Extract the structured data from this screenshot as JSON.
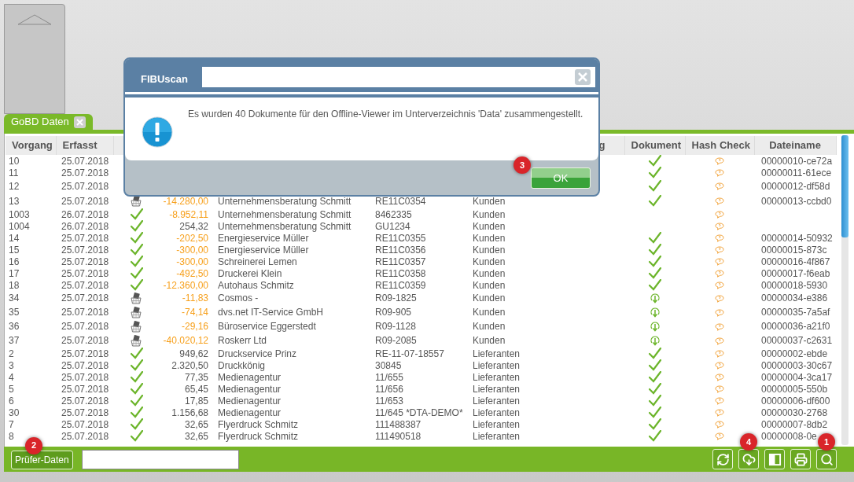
{
  "tab": {
    "label": "GoBD Daten"
  },
  "table": {
    "columns": [
      {
        "label": "Vorgang"
      },
      {
        "label": "Erfasst"
      },
      {
        "label": "g"
      },
      {
        "label": "Dokument"
      },
      {
        "label": "Hash Check"
      },
      {
        "label": "Dateiname"
      }
    ],
    "rows": [
      {
        "vorgang": "10",
        "erfasst": "25.07.2018",
        "dokument": {
          "kind": "check"
        },
        "dateiname": "00000010-ce72a"
      },
      {
        "vorgang": "11",
        "erfasst": "25.07.2018",
        "dokument": {
          "kind": "check"
        },
        "dateiname": "00000011-61ece"
      },
      {
        "vorgang": "12",
        "erfasst": "25.07.2018",
        "dokument": {
          "kind": "check"
        },
        "dateiname": "00000012-df58d"
      },
      {
        "vorgang": "13",
        "erfasst": "25.07.2018",
        "status": {
          "kind": "basket"
        },
        "amount": "-14.280,00",
        "negative": true,
        "name": "Unternehmensberatung Schmitt",
        "beleg": "RE11C0354",
        "kategorie": "Kunden",
        "dokument": {
          "kind": "check"
        },
        "dateiname": "00000013-ccbd0"
      },
      {
        "vorgang": "1003",
        "erfasst": "26.07.2018",
        "status": {
          "kind": "check"
        },
        "amount": "-8.952,11",
        "negative": true,
        "name": "Unternehmensberatung Schmitt",
        "beleg": "8462335",
        "kategorie": "Kunden"
      },
      {
        "vorgang": "1004",
        "erfasst": "26.07.2018",
        "status": {
          "kind": "check"
        },
        "amount": "254,32",
        "negative": false,
        "name": "Unternehmensberatung Schmitt",
        "beleg": "GU1234",
        "kategorie": "Kunden"
      },
      {
        "vorgang": "14",
        "erfasst": "25.07.2018",
        "status": {
          "kind": "check"
        },
        "amount": "-202,50",
        "negative": true,
        "name": "Energieservice Müller",
        "beleg": "RE11C0355",
        "kategorie": "Kunden",
        "dokument": {
          "kind": "check"
        },
        "dateiname": "00000014-50932"
      },
      {
        "vorgang": "15",
        "erfasst": "25.07.2018",
        "status": {
          "kind": "check"
        },
        "amount": "-300,00",
        "negative": true,
        "name": "Energieservice Müller",
        "beleg": "RE11C0356",
        "kategorie": "Kunden",
        "dokument": {
          "kind": "check"
        },
        "dateiname": "00000015-873c"
      },
      {
        "vorgang": "16",
        "erfasst": "25.07.2018",
        "status": {
          "kind": "check"
        },
        "amount": "-300,00",
        "negative": true,
        "name": "Schreinerei Lemen",
        "beleg": "RE11C0357",
        "kategorie": "Kunden",
        "dokument": {
          "kind": "check"
        },
        "dateiname": "00000016-4f867"
      },
      {
        "vorgang": "17",
        "erfasst": "25.07.2018",
        "status": {
          "kind": "check"
        },
        "amount": "-492,50",
        "negative": true,
        "name": "Druckerei Klein",
        "beleg": "RE11C0358",
        "kategorie": "Kunden",
        "dokument": {
          "kind": "check"
        },
        "dateiname": "00000017-f6eab"
      },
      {
        "vorgang": "18",
        "erfasst": "25.07.2018",
        "status": {
          "kind": "check"
        },
        "amount": "-12.360,00",
        "negative": true,
        "name": "Autohaus Schmitz",
        "beleg": "RE11C0359",
        "kategorie": "Kunden",
        "dokument": {
          "kind": "check"
        },
        "dateiname": "00000018-5930"
      },
      {
        "vorgang": "34",
        "erfasst": "25.07.2018",
        "status": {
          "kind": "basket"
        },
        "amount": "-11,83",
        "negative": true,
        "name": "Cosmos -",
        "beleg": "R09-1825",
        "kategorie": "Kunden",
        "dokument": {
          "kind": "download"
        },
        "dateiname": "00000034-e386"
      },
      {
        "vorgang": "35",
        "erfasst": "25.07.2018",
        "status": {
          "kind": "basket"
        },
        "amount": "-74,14",
        "negative": true,
        "name": "dvs.net IT-Service GmbH",
        "beleg": "R09-905",
        "kategorie": "Kunden",
        "dokument": {
          "kind": "download"
        },
        "dateiname": "00000035-7a5af"
      },
      {
        "vorgang": "36",
        "erfasst": "25.07.2018",
        "status": {
          "kind": "basket"
        },
        "amount": "-29,16",
        "negative": true,
        "name": "Büroservice Eggerstedt",
        "beleg": "R09-1128",
        "kategorie": "Kunden",
        "dokument": {
          "kind": "download"
        },
        "dateiname": "00000036-a21f0"
      },
      {
        "vorgang": "37",
        "erfasst": "25.07.2018",
        "status": {
          "kind": "basket"
        },
        "amount": "-40.020,12",
        "negative": true,
        "name": "Roskerr Ltd",
        "beleg": "R09-2085",
        "kategorie": "Kunden",
        "dokument": {
          "kind": "download"
        },
        "dateiname": "00000037-c2631"
      },
      {
        "vorgang": "2",
        "erfasst": "25.07.2018",
        "status": {
          "kind": "check"
        },
        "amount": "949,62",
        "negative": false,
        "name": "Druckservice Prinz",
        "beleg": "RE-11-07-18557",
        "kategorie": "Lieferanten",
        "dokument": {
          "kind": "check"
        },
        "dateiname": "00000002-ebde"
      },
      {
        "vorgang": "3",
        "erfasst": "25.07.2018",
        "status": {
          "kind": "check"
        },
        "amount": "2.320,50",
        "negative": false,
        "name": "Druckkönig",
        "beleg": "30845",
        "kategorie": "Lieferanten",
        "dokument": {
          "kind": "check"
        },
        "dateiname": "00000003-30c67"
      },
      {
        "vorgang": "4",
        "erfasst": "25.07.2018",
        "status": {
          "kind": "check"
        },
        "amount": "77,35",
        "negative": false,
        "name": "Medienagentur",
        "beleg": "11/655",
        "kategorie": "Lieferanten",
        "dokument": {
          "kind": "check"
        },
        "dateiname": "00000004-3ca17"
      },
      {
        "vorgang": "5",
        "erfasst": "25.07.2018",
        "status": {
          "kind": "check"
        },
        "amount": "65,45",
        "negative": false,
        "name": "Medienagentur",
        "beleg": "11/656",
        "kategorie": "Lieferanten",
        "dokument": {
          "kind": "check"
        },
        "dateiname": "00000005-550b"
      },
      {
        "vorgang": "6",
        "erfasst": "25.07.2018",
        "status": {
          "kind": "check"
        },
        "amount": "17,85",
        "negative": false,
        "name": "Medienagentur",
        "beleg": "11/653",
        "kategorie": "Lieferanten",
        "dokument": {
          "kind": "check"
        },
        "dateiname": "00000006-df600"
      },
      {
        "vorgang": "30",
        "erfasst": "25.07.2018",
        "status": {
          "kind": "check"
        },
        "amount": "1.156,68",
        "negative": false,
        "name": "Medienagentur",
        "beleg": "11/645 *DTA-DEMO*",
        "kategorie": "Lieferanten",
        "dokument": {
          "kind": "check"
        },
        "dateiname": "00000030-2768"
      },
      {
        "vorgang": "7",
        "erfasst": "25.07.2018",
        "status": {
          "kind": "check"
        },
        "amount": "32,65",
        "negative": false,
        "name": "Flyerdruck Schmitz",
        "beleg": "111488387",
        "kategorie": "Lieferanten",
        "dokument": {
          "kind": "check"
        },
        "dateiname": "00000007-8db2"
      },
      {
        "vorgang": "8",
        "erfasst": "25.07.2018",
        "status": {
          "kind": "check"
        },
        "amount": "32,65",
        "negative": false,
        "name": "Flyerdruck Schmitz",
        "beleg": "111490518",
        "kategorie": "Lieferanten",
        "dokument": {
          "kind": "check"
        },
        "dateiname": "00000008-0e"
      }
    ]
  },
  "footer": {
    "button": {
      "label": "Prüfer-Daten",
      "badge": "2"
    },
    "tools": [
      {
        "kind": "refresh"
      },
      {
        "kind": "download",
        "badge": "4"
      },
      {
        "kind": "save"
      },
      {
        "kind": "print"
      },
      {
        "kind": "search",
        "badge": "1"
      }
    ]
  },
  "dialog": {
    "title": "FIBUscan",
    "message": "Es wurden 40 Dokumente für den Offline-Viewer im Unterverzeichnis 'Data' zusammengestellt.",
    "ok_button": {
      "label": "OK",
      "badge": "3"
    }
  }
}
